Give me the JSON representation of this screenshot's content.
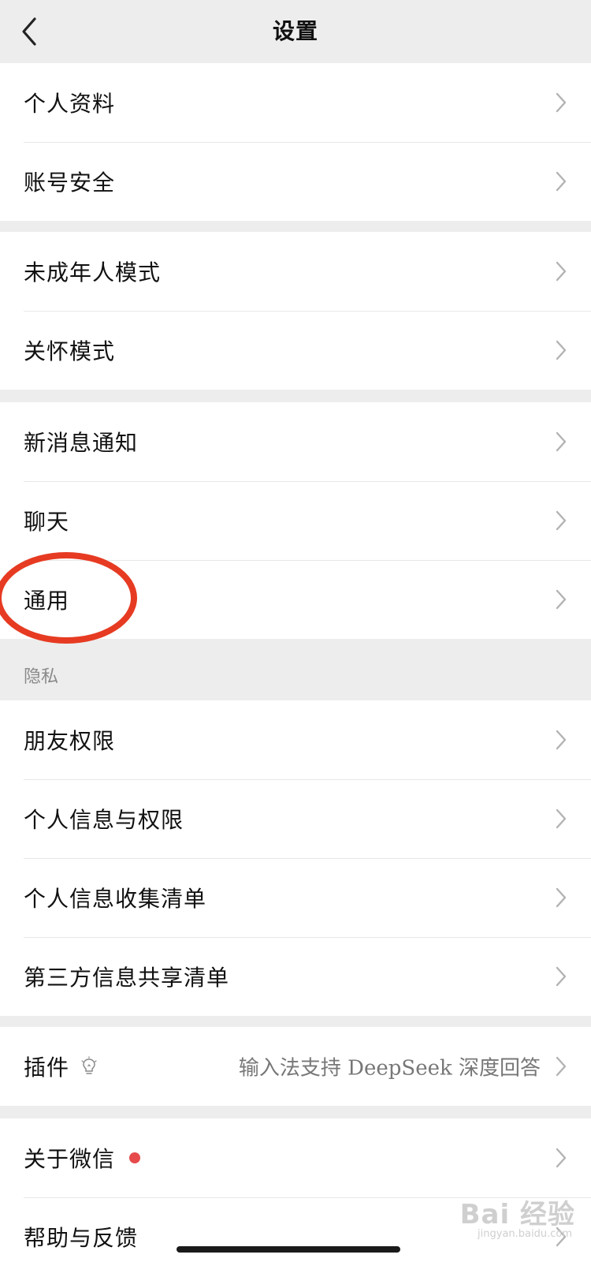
{
  "header": {
    "title": "设置"
  },
  "groups": [
    {
      "items": [
        {
          "label": "个人资料"
        },
        {
          "label": "账号安全"
        }
      ]
    },
    {
      "items": [
        {
          "label": "未成年人模式"
        },
        {
          "label": "关怀模式"
        }
      ]
    },
    {
      "items": [
        {
          "label": "新消息通知"
        },
        {
          "label": "聊天"
        },
        {
          "label": "通用"
        }
      ]
    },
    {
      "header": "隐私",
      "items": [
        {
          "label": "朋友权限"
        },
        {
          "label": "个人信息与权限"
        },
        {
          "label": "个人信息收集清单"
        },
        {
          "label": "第三方信息共享清单"
        }
      ]
    },
    {
      "items": [
        {
          "label": "插件",
          "right_text": "输入法支持 DeepSeek 深度回答",
          "icon": "lightbulb-icon"
        }
      ]
    },
    {
      "items": [
        {
          "label": "关于微信",
          "badge": "red-dot"
        },
        {
          "label": "帮助与反馈"
        }
      ]
    }
  ],
  "highlight": {
    "target": "通用",
    "color": "#e63b22"
  },
  "watermark": {
    "main": "Bai 经验",
    "sub": "jingyan.baidu.com"
  },
  "colors": {
    "background": "#ededed",
    "card": "#ffffff",
    "chevron": "#b3b3b3",
    "badge": "#e64a4a"
  }
}
